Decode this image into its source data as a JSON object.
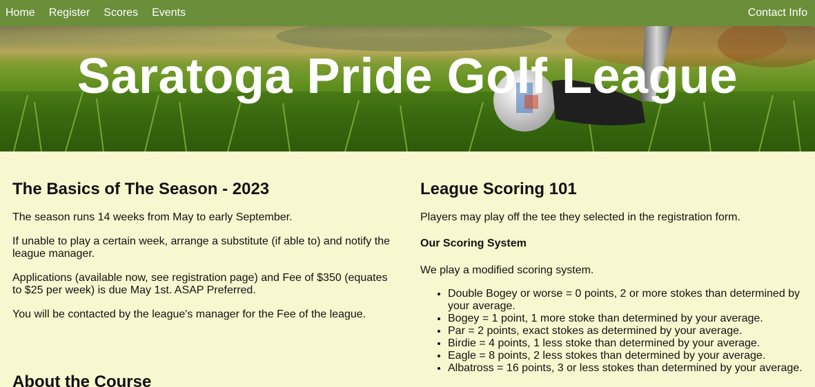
{
  "nav": {
    "links": [
      "Home",
      "Register",
      "Scores",
      "Events"
    ],
    "contact": "Contact Info"
  },
  "hero": {
    "title": "Saratoga Pride Golf League"
  },
  "basics": {
    "heading": "The Basics of The Season - 2023",
    "paragraphs": [
      "The season runs 14 weeks from May to early September.",
      "If unable to play a certain week, arrange a substitute (if able to) and notify the league manager.",
      "Applications (available now, see registration page) and Fee of $350 (equates to $25 per week) is due May 1st. ASAP Preferred.",
      "You will be contacted by the league's manager for the Fee of the league."
    ]
  },
  "course": {
    "heading": "About the Course"
  },
  "scoring": {
    "heading": "League Scoring 101",
    "intro": "Players may play off the tee they selected in the registration form.",
    "subheading": "Our Scoring System",
    "modified": "We play a modified scoring system.",
    "items": [
      "Double Bogey or worse = 0 points, 2 or more stokes than determined by your average.",
      "Bogey = 1 point, 1 more stoke than determined by your average.",
      "Par = 2 points, exact stokes as determined by your average.",
      "Birdie = 4 points, 1 less stoke than determined by your average.",
      "Eagle = 8 points, 2 less stokes than determined by your average.",
      "Albatross = 16 points, 3 or less stokes than determined by your average."
    ]
  },
  "colors": {
    "nav_bg": "#6b8e3a",
    "page_bg": "#f8f8d0",
    "nav_text": "#ffffff"
  }
}
